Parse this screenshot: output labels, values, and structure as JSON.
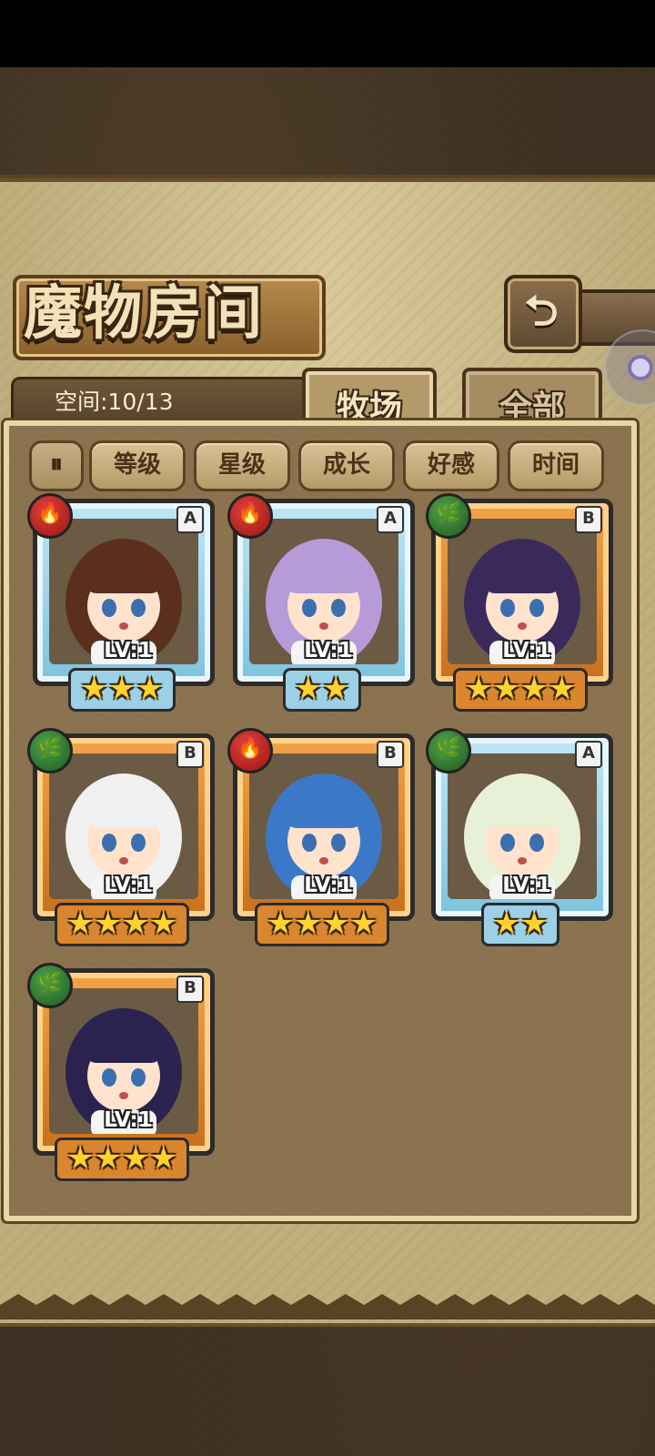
{
  "title": "魔物房间",
  "back_icon": "back-arrow-icon",
  "space_label": "空间:10/13",
  "tabs": [
    {
      "label": "牧场",
      "active": true
    },
    {
      "label": "全部",
      "active": false
    }
  ],
  "sort_toggle_icon": "sort-toggle-icon",
  "filters": [
    "等级",
    "星级",
    "成长",
    "好感",
    "时间"
  ],
  "monsters": [
    {
      "element": "fire",
      "element_icon": "fire-icon",
      "rank": "A",
      "level": "LV:1",
      "stars": 3
    },
    {
      "element": "fire",
      "element_icon": "fire-icon",
      "rank": "A",
      "level": "LV:1",
      "stars": 2
    },
    {
      "element": "leaf",
      "element_icon": "leaf-icon",
      "rank": "B",
      "level": "LV:1",
      "stars": 4
    },
    {
      "element": "leaf",
      "element_icon": "leaf-icon",
      "rank": "B",
      "level": "LV:1",
      "stars": 4
    },
    {
      "element": "fire",
      "element_icon": "fire-icon",
      "rank": "B",
      "level": "LV:1",
      "stars": 4
    },
    {
      "element": "leaf",
      "element_icon": "leaf-icon",
      "rank": "A",
      "level": "LV:1",
      "stars": 2
    },
    {
      "element": "leaf",
      "element_icon": "leaf-icon",
      "rank": "B",
      "level": "LV:1",
      "stars": 4
    }
  ],
  "colors": {
    "rank_a_frame": "#7ec3de",
    "rank_b_frame": "#c8701c",
    "fire": "#c0241f",
    "leaf": "#2f7a2d",
    "star": "#ffd22e"
  }
}
